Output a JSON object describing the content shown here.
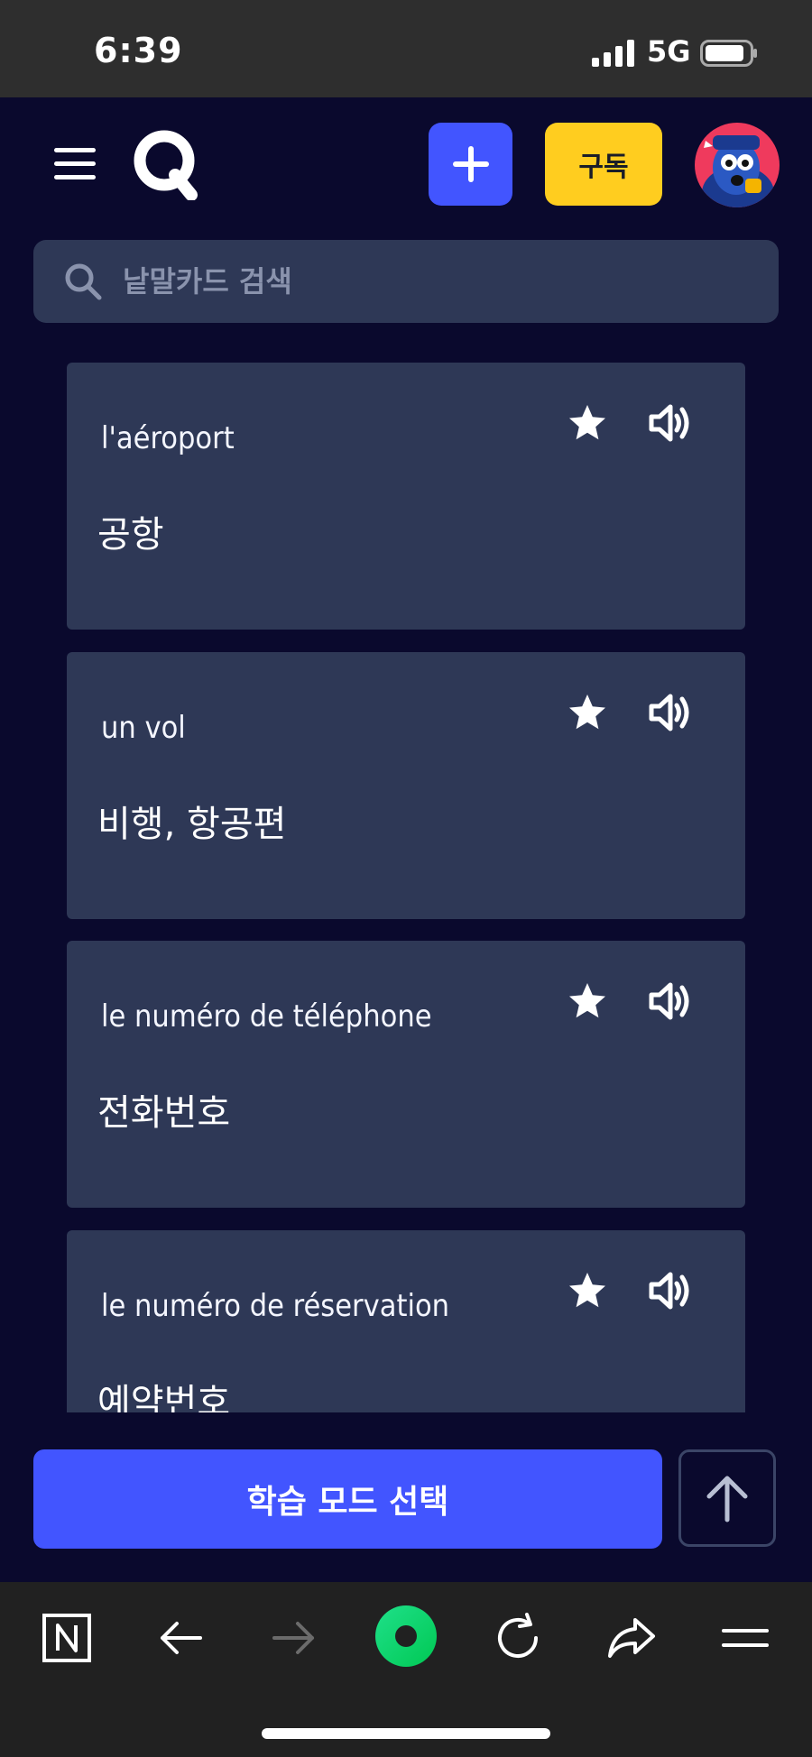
{
  "status_bar": {
    "time": "6:39",
    "network": "5G"
  },
  "header": {
    "subscribe_label": "구독"
  },
  "search": {
    "placeholder": "낱말카드 검색"
  },
  "cards": [
    {
      "term": "l'aéroport",
      "definition": "공항"
    },
    {
      "term": "un vol",
      "definition": "비행, 항공편"
    },
    {
      "term": "le numéro de téléphone",
      "definition": "전화번호"
    },
    {
      "term": "le numéro de réservation",
      "definition": "예약번호"
    }
  ],
  "actions": {
    "study_mode_label": "학습 모드 선택"
  },
  "icons": {
    "menu": "hamburger-menu-icon",
    "logo": "quizlet-logo",
    "create": "plus-icon",
    "search": "search-icon",
    "star": "star-icon",
    "audio": "speaker-icon",
    "scroll_top": "arrow-up-icon",
    "browser": [
      "notion-icon",
      "back-arrow-icon",
      "forward-arrow-icon",
      "app-home-icon",
      "reload-icon",
      "share-icon",
      "browser-menu-icon"
    ]
  },
  "colors": {
    "background": "#0a092d",
    "card": "#2e3856",
    "primary": "#4255ff",
    "subscribe": "#ffcd1f",
    "browser_toolbar": "#212121",
    "status_bar": "#2e2e2e"
  }
}
